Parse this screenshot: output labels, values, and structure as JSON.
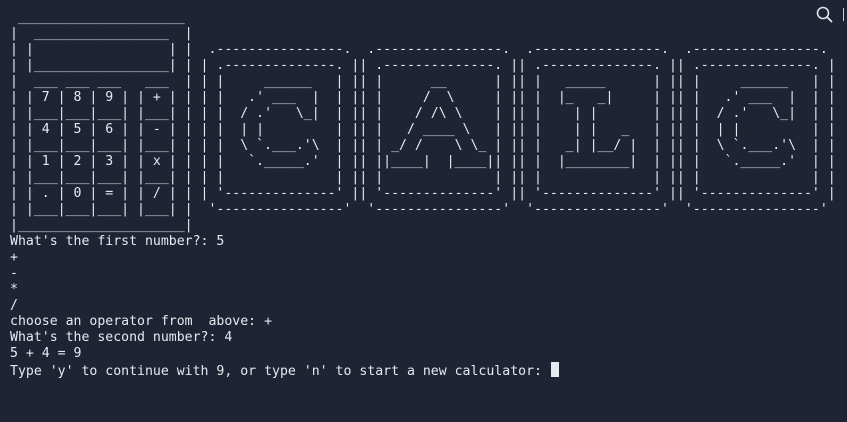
{
  "banner": {
    "ascii_art": " _____________________\n|  _________________  |\n| |                 | |  .----------------.  .----------------.  .----------------.  .----------------.\n| |_________________| | | .--------------. || .--------------. || .--------------. || .--------------. |\n|  ___ ___ ___   ___  | | |     ______   | || |      __      | || |   _____      | || |     ______   | |\n| | 7 | 8 | 9 | | + | | | |   .' ___  |  | || |     /  \\     | || |  |_   _|     | || |   .' ___  |  | |\n| |___|___|___| |___| | | |  / .'   \\_|  | || |    / /\\ \\    | || |    | |       | || |  / .'   \\_|  | |\n| | 4 | 5 | 6 | | - | | | |  | |         | || |   / ____ \\   | || |    | |   _   | || |  | |         | |\n| |___|___|___| |___| | | |  \\ `.___.'\\  | || | _/ /    \\ \\_ | || |   _| |__/ |  | || |  \\ `.___.'\\  | |\n| | 1 | 2 | 3 | | x | | | |   `._____.'  | || ||____|  |____|| || |  |________|  | || |   `._____.'  | |\n| |___|___|___| |___| | | |              | || |              | || |              | || |              | |\n| | . | 0 | = | | / | | | '--------------' || '--------------' || '--------------' || '--------------' |\n| |___|___|___| |___| |  '----------------'  '----------------'  '----------------'  '----------------'\n|_____________________|"
  },
  "session": {
    "lines": [
      "What's the first number?: 5",
      "+",
      "-",
      "*",
      "/",
      "choose an operator from  above: +",
      "What's the second number?: 4",
      "5 + 4 = 9",
      "Type 'y' to continue with 9, or type 'n' to start a new calculator: "
    ]
  },
  "icons": {
    "search": "search-icon"
  },
  "colors": {
    "background": "#1e2433",
    "foreground": "#e6e9ef"
  }
}
